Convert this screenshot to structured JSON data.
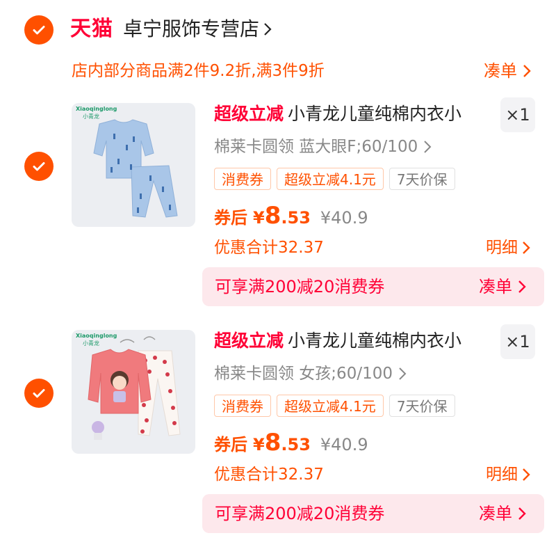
{
  "shop": {
    "tmall_label": "天猫",
    "name": "卓宁服饰专营店",
    "promo_text": "店内部分商品满2件9.2折,满3件9折",
    "promo_link": "凑单"
  },
  "items": [
    {
      "brand_en": "Xiaoqinglong",
      "brand_cn": "小青龙",
      "title_tag": "超级立减",
      "title": "小青龙儿童纯棉内衣小",
      "qty": "×1",
      "sku": "棉莱卡圆领 蓝大眼F;60/100",
      "badges": [
        "消费券",
        "超级立减4.1元",
        "7天价保"
      ],
      "coupon_after": "券后",
      "yen": "¥",
      "price_int": "8",
      "price_dec": ".53",
      "orig_price": "¥40.9",
      "discount_total": "优惠合计32.37",
      "detail_label": "明细",
      "coupon_text": "可享满200减20消费券",
      "coupon_link": "凑单"
    },
    {
      "brand_en": "Xiaoqinglong",
      "brand_cn": "小青龙",
      "title_tag": "超级立减",
      "title": "小青龙儿童纯棉内衣小",
      "qty": "×1",
      "sku": "棉莱卡圆领 女孩;60/100",
      "badges": [
        "消费券",
        "超级立减4.1元",
        "7天价保"
      ],
      "coupon_after": "券后",
      "yen": "¥",
      "price_int": "8",
      "price_dec": ".53",
      "orig_price": "¥40.9",
      "discount_total": "优惠合计32.37",
      "detail_label": "明细",
      "coupon_text": "可享满200减20消费券",
      "coupon_link": "凑单"
    }
  ],
  "colors": {
    "accent": "#ff5000",
    "tmall_red": "#ff0036",
    "coupon_bg": "#fde8ec"
  },
  "icons": {
    "check": "checkmark-icon",
    "chevron": "chevron-right-icon"
  }
}
